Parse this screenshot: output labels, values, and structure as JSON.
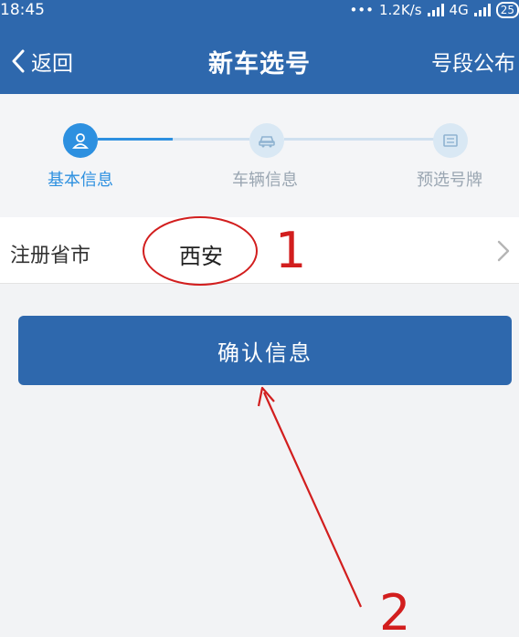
{
  "status": {
    "time": "18:45",
    "dots": "•••",
    "speed": "1.2K/s",
    "network": "4G",
    "battery": "25"
  },
  "nav": {
    "back_label": "返回",
    "title": "新车选号",
    "right_action": "号段公布"
  },
  "steps": [
    {
      "label": "基本信息",
      "icon": "user-icon",
      "active": true
    },
    {
      "label": "车辆信息",
      "icon": "car-icon",
      "active": false
    },
    {
      "label": "预选号牌",
      "icon": "plate-icon",
      "active": false
    }
  ],
  "form": {
    "row_label": "注册省市",
    "row_value": "西安"
  },
  "confirm_label": "确认信息",
  "annotations": {
    "one": "1",
    "two": "2"
  },
  "colors": {
    "brand": "#2e68ad",
    "active_step": "#2d90e0",
    "annotation": "#d21e1e"
  }
}
